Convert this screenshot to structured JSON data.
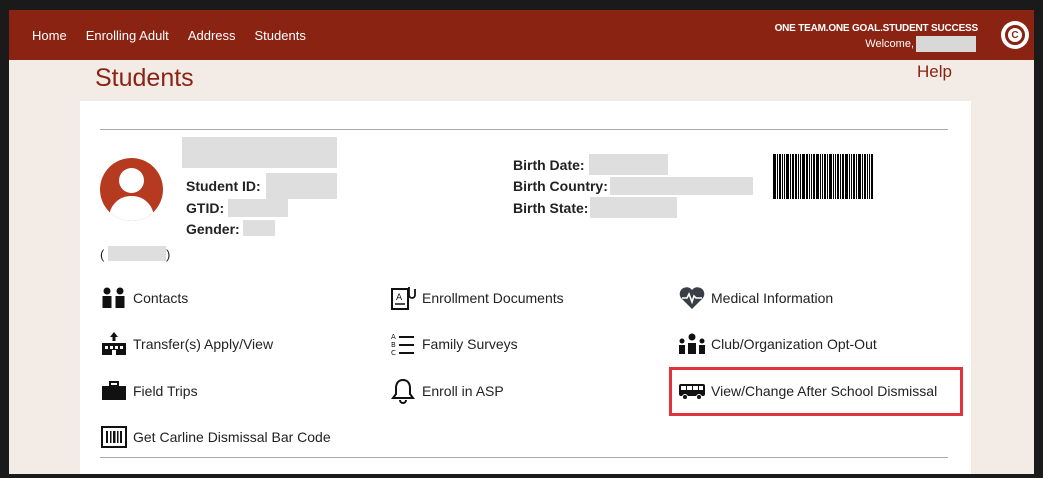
{
  "nav": {
    "items": [
      "Home",
      "Enrolling Adult",
      "Address",
      "Students"
    ]
  },
  "header": {
    "slogan": "ONE TEAM.ONE GOAL.STUDENT SUCCESS",
    "welcome": "Welcome,",
    "logo_letter": "C"
  },
  "page": {
    "title": "Students",
    "help": "Help"
  },
  "student": {
    "id_label": "Student ID:",
    "gtid_label": "GTID:",
    "gender_label": "Gender:",
    "birth_date_label": "Birth Date:",
    "birth_country_label": "Birth Country:",
    "birth_state_label": "Birth State:",
    "paren_open": "(",
    "paren_close": ")"
  },
  "links": {
    "contacts": "Contacts",
    "enrollment_documents": "Enrollment Documents",
    "medical_information": "Medical Information",
    "transfers": "Transfer(s) Apply/View",
    "family_surveys": "Family Surveys",
    "club_opt_out": "Club/Organization Opt-Out",
    "field_trips": "Field Trips",
    "enroll_asp": "Enroll in ASP",
    "dismissal": "View/Change After School Dismissal",
    "carline_barcode": "Get Carline Dismissal Bar Code"
  },
  "colors": {
    "brand": "#8b2312",
    "highlight": "#e0333b"
  }
}
